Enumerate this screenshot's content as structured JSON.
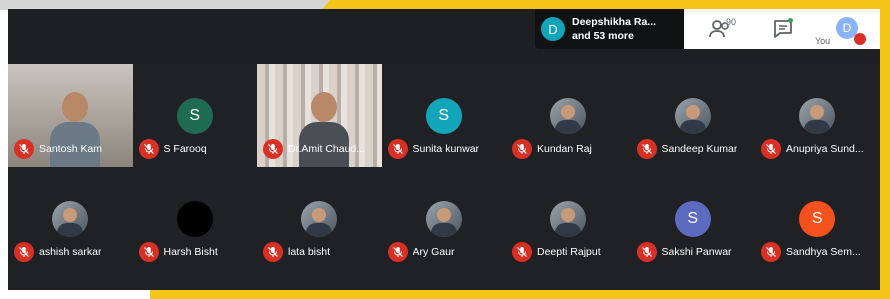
{
  "presenter_chip": {
    "initial": "D",
    "name": "Deepshikha Ra...",
    "more": "and 53 more"
  },
  "toolbar": {
    "people_count": "90",
    "you_label": "You",
    "self_initial": "D"
  },
  "colors": {
    "meeting_bg": "#202124",
    "mic_off_red": "#d93025",
    "frame_gold": "#f5c518"
  },
  "participants": [
    {
      "name": "Santosh Kam",
      "avatar_type": "video"
    },
    {
      "name": "S Farooq",
      "avatar_type": "initial",
      "initial": "S",
      "color": "#1e6b52"
    },
    {
      "name": "Dr.Amit Chaud...",
      "avatar_type": "video"
    },
    {
      "name": "Sunita kunwar",
      "avatar_type": "initial",
      "initial": "S",
      "color": "#12a4b8"
    },
    {
      "name": "Kundan Raj",
      "avatar_type": "photo"
    },
    {
      "name": "Sandeep Kumar",
      "avatar_type": "photo"
    },
    {
      "name": "Anupriya Sund...",
      "avatar_type": "photo"
    },
    {
      "name": "ashish sarkar",
      "avatar_type": "photo"
    },
    {
      "name": "Harsh Bisht",
      "avatar_type": "black"
    },
    {
      "name": "lata bisht",
      "avatar_type": "photo"
    },
    {
      "name": "Ary Gaur",
      "avatar_type": "photo"
    },
    {
      "name": "Deepti Rajput",
      "avatar_type": "photo"
    },
    {
      "name": "Sakshi Panwar",
      "avatar_type": "initial",
      "initial": "S",
      "color": "#5c6bc0"
    },
    {
      "name": "Sandhya Sem...",
      "avatar_type": "initial",
      "initial": "S",
      "color": "#f4511e"
    }
  ]
}
